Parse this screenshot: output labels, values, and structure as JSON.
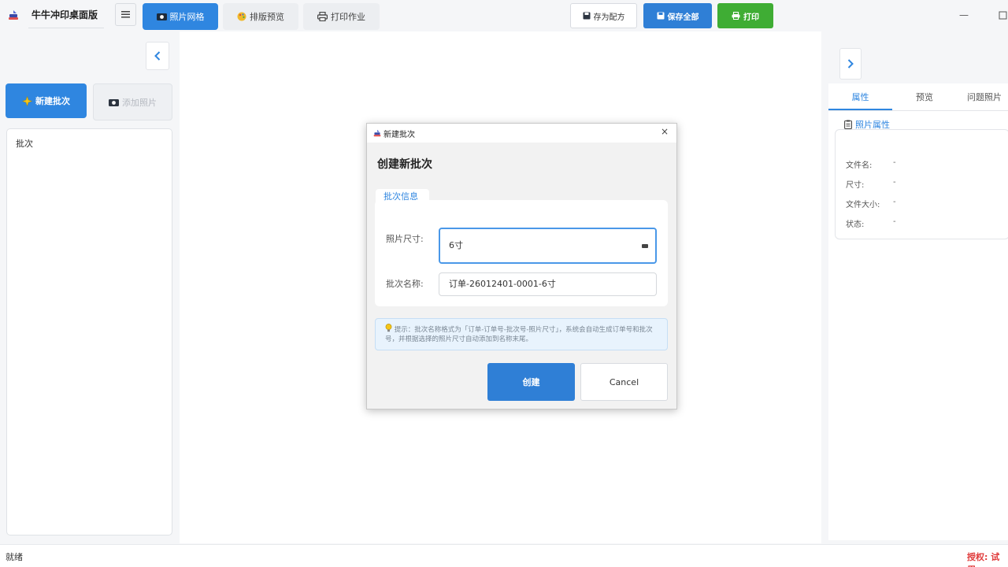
{
  "app": {
    "title": "牛牛冲印桌面版"
  },
  "tabs": [
    {
      "label": "照片网格",
      "icon": "camera-icon",
      "active": true
    },
    {
      "label": "排版预览",
      "icon": "palette-icon",
      "active": false
    },
    {
      "label": "打印作业",
      "icon": "printer-icon",
      "active": false
    }
  ],
  "toolbar": {
    "save_recipe": "存为配方",
    "save_all": "保存全部",
    "print": "打印"
  },
  "window": {
    "minimize_glyph": "—"
  },
  "left_panel": {
    "new_batch": "新建批次",
    "add_photo": "添加照片",
    "list_header": "批次"
  },
  "right_panel": {
    "tabs": [
      "属性",
      "预览",
      "问题照片"
    ],
    "section_title": "照片属性",
    "props": [
      {
        "label": "文件名:",
        "value": "-"
      },
      {
        "label": "尺寸:",
        "value": "-"
      },
      {
        "label": "文件大小:",
        "value": "-"
      },
      {
        "label": "状态:",
        "value": "-"
      }
    ]
  },
  "dialog": {
    "title": "新建批次",
    "close": "×",
    "heading": "创建新批次",
    "group_title": "批次信息",
    "size_label": "照片尺寸:",
    "size_value": "6寸",
    "name_label": "批次名称:",
    "name_value": "订单-26012401-0001-6寸",
    "tip": "提示：批次名称格式为「订单-订单号-批次号-照片尺寸」，系统会自动生成订单号和批次号，并根据选择的照片尺寸自动添加到名称末尾。",
    "create": "创建",
    "cancel": "Cancel"
  },
  "status": {
    "text": "就绪",
    "license": "授权: 试用"
  },
  "colors": {
    "primary": "#2f86e0",
    "success": "#3fad34",
    "license_red": "#e03a3a"
  }
}
